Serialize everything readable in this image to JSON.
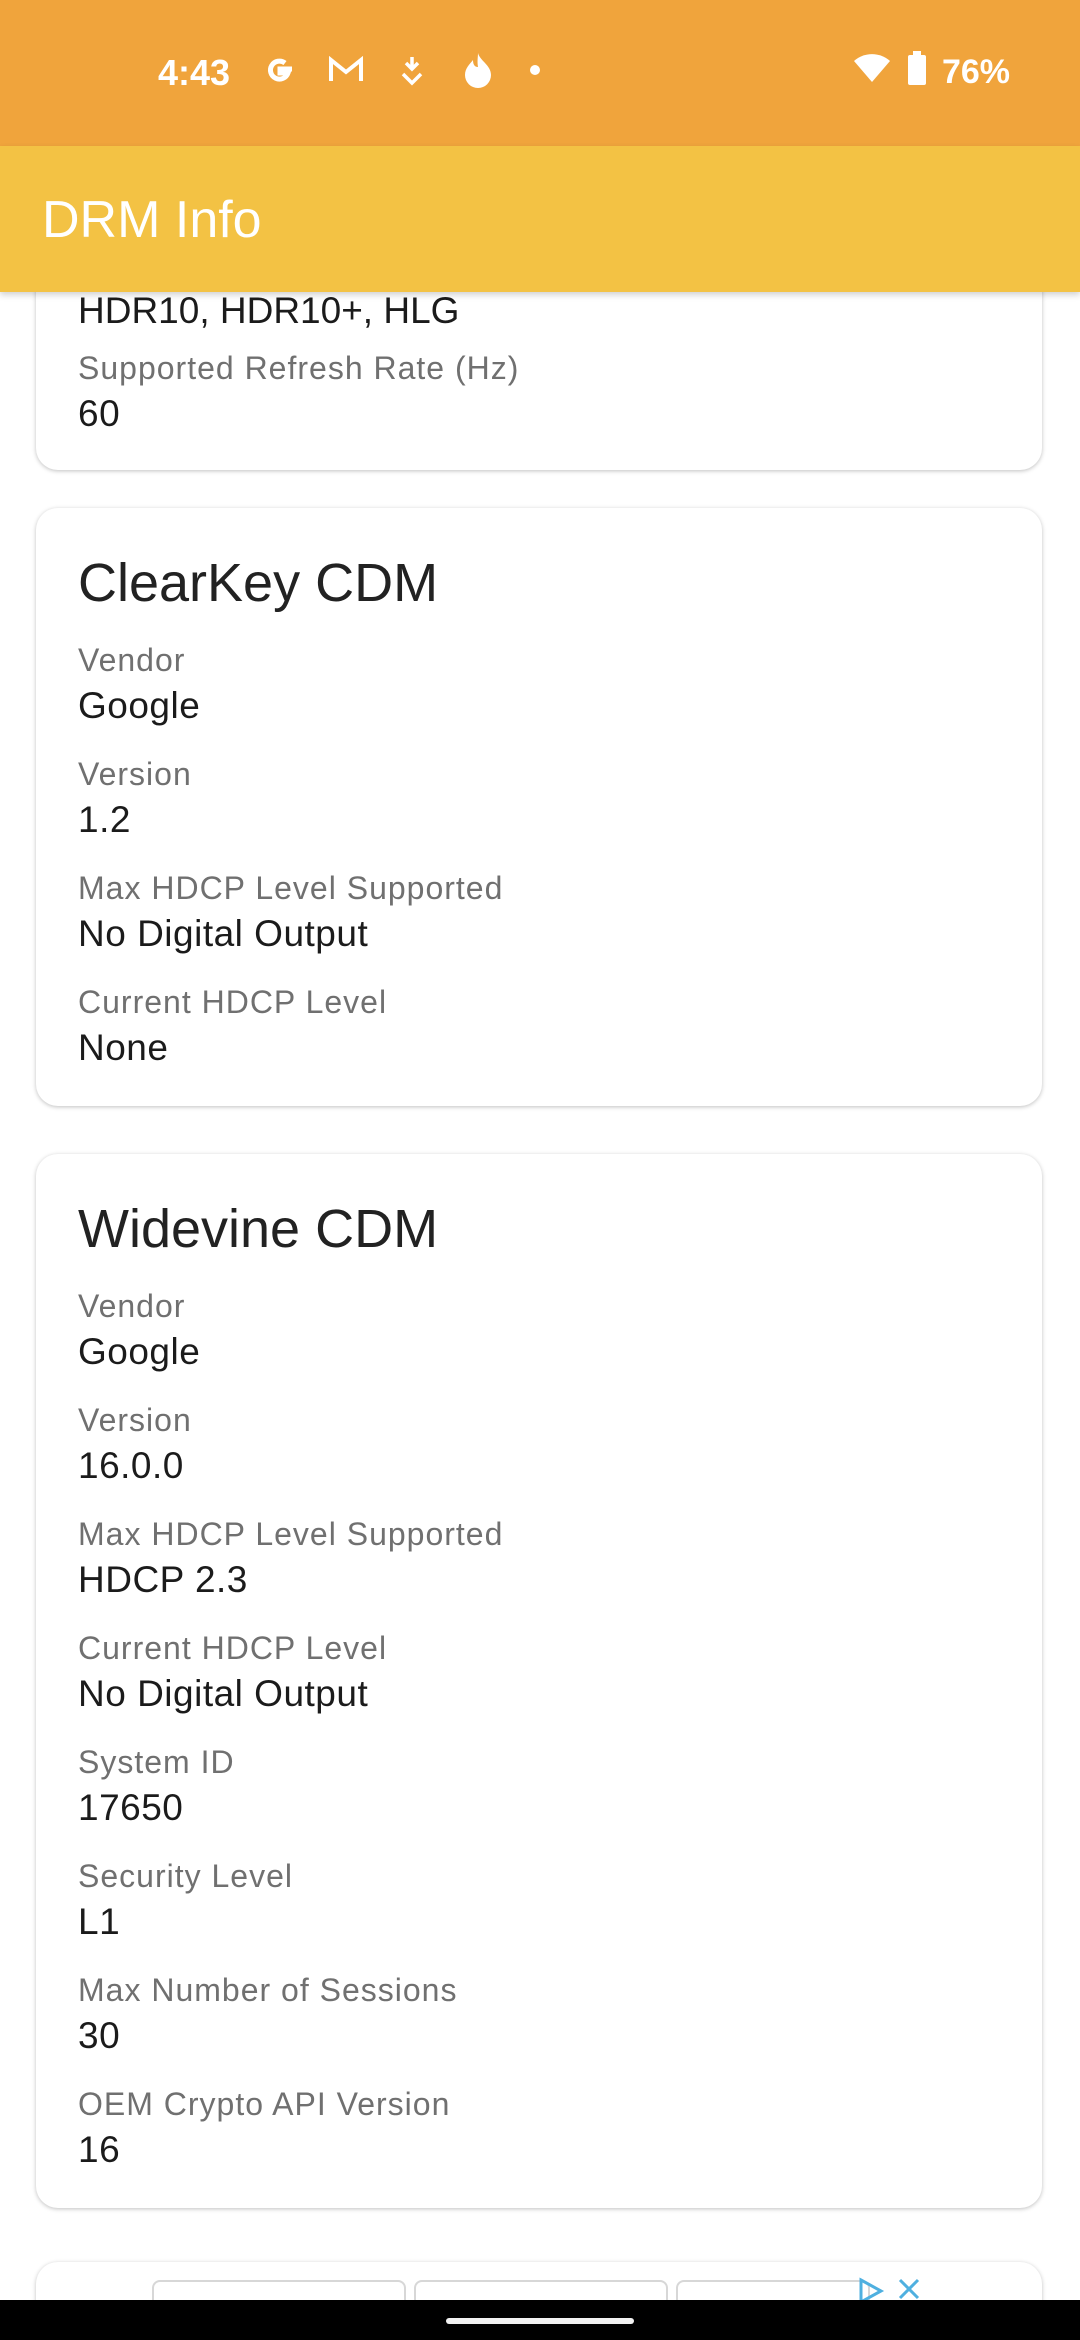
{
  "status_bar": {
    "time": "4:43",
    "battery": "76%",
    "icons": [
      "google-g-icon",
      "gmail-icon",
      "download-icon",
      "fire-icon",
      "dot-icon",
      "wifi-icon",
      "battery-icon"
    ]
  },
  "app_bar": {
    "title": "DRM Info"
  },
  "display_card": {
    "partial_value": "HDR10, HDR10+, HLG",
    "fields": [
      {
        "label": "Supported Refresh Rate (Hz)",
        "value": "60"
      }
    ]
  },
  "clearkey_card": {
    "title": "ClearKey CDM",
    "fields": [
      {
        "label": "Vendor",
        "value": "Google"
      },
      {
        "label": "Version",
        "value": "1.2"
      },
      {
        "label": "Max HDCP Level Supported",
        "value": "No Digital Output"
      },
      {
        "label": "Current HDCP Level",
        "value": "None"
      }
    ]
  },
  "widevine_card": {
    "title": "Widevine CDM",
    "fields": [
      {
        "label": "Vendor",
        "value": "Google"
      },
      {
        "label": "Version",
        "value": "16.0.0"
      },
      {
        "label": "Max HDCP Level Supported",
        "value": "HDCP 2.3"
      },
      {
        "label": "Current HDCP Level",
        "value": "No Digital Output"
      },
      {
        "label": "System ID",
        "value": "17650"
      },
      {
        "label": "Security Level",
        "value": "L1"
      },
      {
        "label": "Max Number of Sessions",
        "value": "30"
      },
      {
        "label": "OEM Crypto API Version",
        "value": "16"
      }
    ]
  },
  "colors": {
    "status_bar": "#F0A43C",
    "app_bar": "#F3C244",
    "ad_accent": "#4FB0E0"
  }
}
